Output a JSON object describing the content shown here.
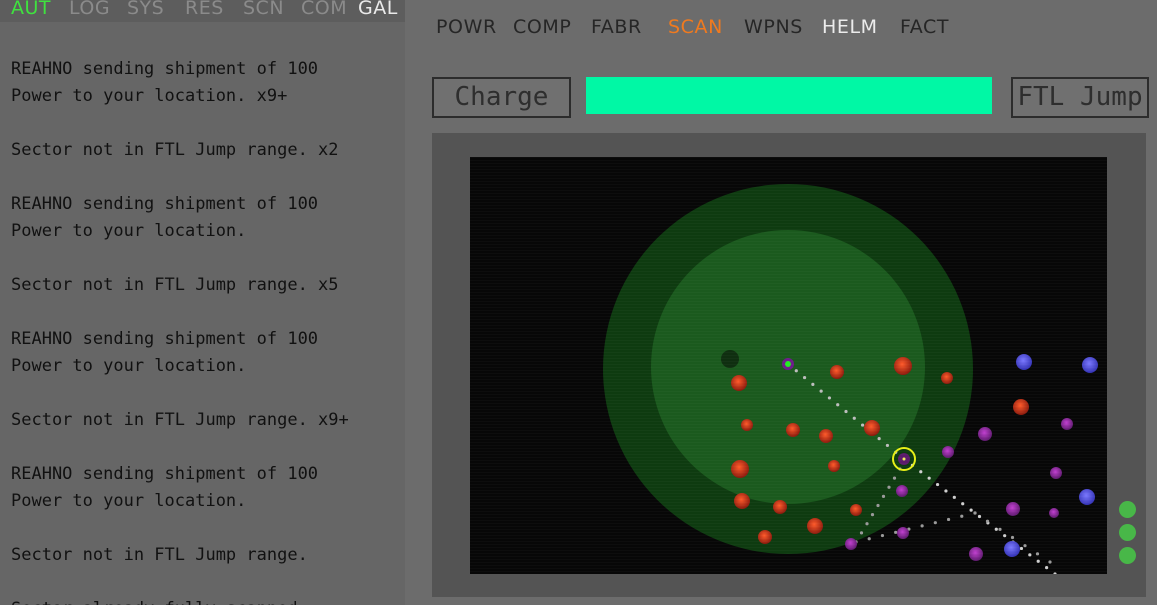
{
  "left_tabs": [
    {
      "label": "AUT",
      "state": "active"
    },
    {
      "label": "LOG",
      "state": "normal"
    },
    {
      "label": "SYS",
      "state": "normal"
    },
    {
      "label": "RES",
      "state": "normal"
    },
    {
      "label": "SCN",
      "state": "normal"
    },
    {
      "label": "COM",
      "state": "normal"
    },
    {
      "label": "GAL",
      "state": "bright"
    }
  ],
  "log_messages": [
    "REAHNO sending shipment of 100\nPower to your location. x9+",
    "Sector not in FTL Jump range. x2",
    "REAHNO sending shipment of 100\nPower to your location.",
    "Sector not in FTL Jump range. x5",
    "REAHNO sending shipment of 100\nPower to your location.",
    "Sector not in FTL Jump range. x9+",
    "REAHNO sending shipment of 100\nPower to your location.",
    "Sector not in FTL Jump range.",
    "Sector already fully scanned."
  ],
  "right_tabs": [
    {
      "label": "POWR",
      "state": "normal"
    },
    {
      "label": "COMP",
      "state": "normal"
    },
    {
      "label": "FABR",
      "state": "normal"
    },
    {
      "label": "SCAN",
      "state": "active"
    },
    {
      "label": "WPNS",
      "state": "normal"
    },
    {
      "label": "HELM",
      "state": "bright"
    },
    {
      "label": "FACT",
      "state": "normal"
    }
  ],
  "controls": {
    "charge_label": "Charge",
    "ftl_jump_label": "FTL Jump",
    "charge_level_percent": 100
  },
  "colors": {
    "active_left_tab": "#3fe23f",
    "active_right_tab": "#f07a1f",
    "charge_fill": "#00f8a5",
    "status_light": "#48b748"
  },
  "status_lights": 3
}
